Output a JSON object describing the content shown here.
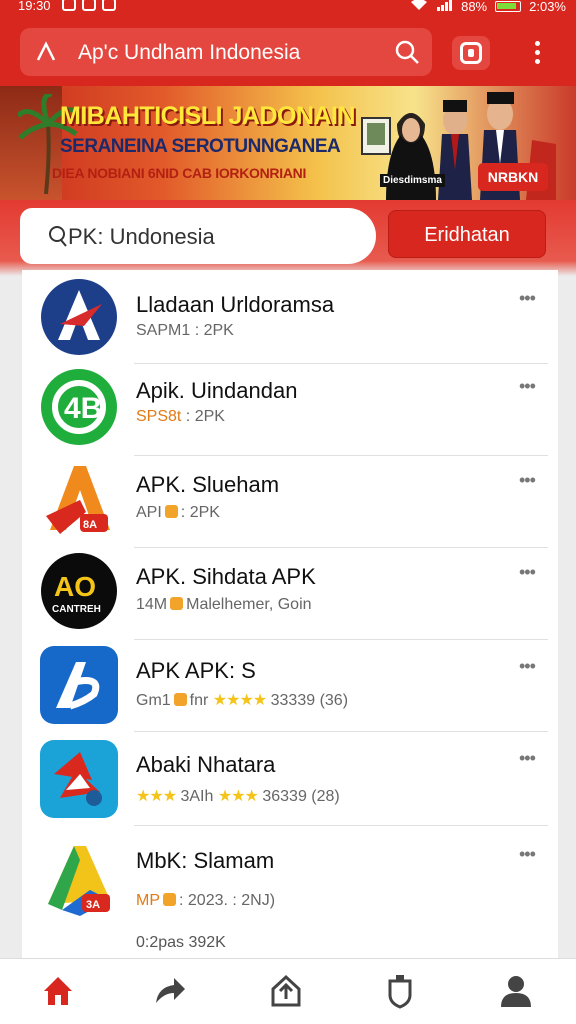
{
  "status_bar": {
    "time": "19:30",
    "battery": "88%",
    "clock_right": "2:03%"
  },
  "browser": {
    "url": "Ap'c Undham Indonesia"
  },
  "banner": {
    "line1": "MIBAHTICISLI JADONAIN",
    "line2": "SERANEINA SEROTUNNGANEA",
    "line3": "DIEA NOBIANI 6NID CAB IORKONRIANI",
    "caption": "Diesdimsma",
    "promo": "NRBKN"
  },
  "search": {
    "value": "PK: Undonesia",
    "button_label": "Eridhatan"
  },
  "apps": [
    {
      "name": "Lladaan Urldoramsa",
      "meta_prefix": "",
      "meta": "SAPM1 : 2PK"
    },
    {
      "name": "Apik. Uindandan",
      "meta_prefix": "SPS8t",
      "meta": " : 2PK"
    },
    {
      "name": "APK. Slueham",
      "meta_prefix": "",
      "meta": "API",
      "meta_suffix": ": 2PK"
    },
    {
      "name": "APK. Sihdata APK",
      "meta_prefix": "",
      "meta": "14M",
      "meta_suffix": "Malelhemer, Goin"
    },
    {
      "name": "APK APK: S",
      "meta_prefix": "",
      "meta": "Gm1",
      "meta_suffix": "fnr",
      "stars": "★★★★",
      "rating": "33339 (36)"
    },
    {
      "name": "Abaki Nhatara",
      "stars": "★★★",
      "meta": "3AIh",
      "stars2": "★★★",
      "rating": "36339 (28)"
    },
    {
      "name": "MbK: Slamam",
      "meta_prefix": "MP",
      "meta_suffix": ": 2023. : 2NJ)",
      "meta": ""
    }
  ],
  "footer_text": "0:2pas 392K",
  "icons": {
    "status": [
      "message-icon",
      "phone-icon",
      "app-icon"
    ],
    "nav": [
      "home-icon",
      "share-icon",
      "upload-icon",
      "shield-icon",
      "profile-icon"
    ]
  },
  "colors": {
    "brand_red": "#d8271e",
    "star": "#f4c419",
    "orange": "#e07a14"
  }
}
